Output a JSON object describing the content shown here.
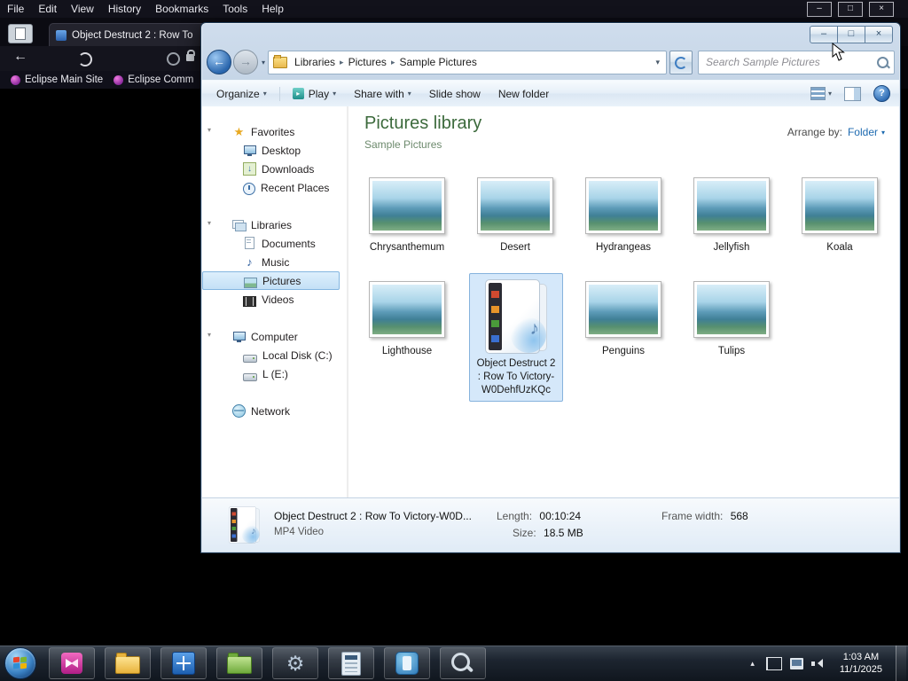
{
  "icons": {
    "back": "←",
    "forward": "→",
    "dropdown": "▾",
    "crumb_sep": "▸",
    "star": "★",
    "note": "♪",
    "down": "↓",
    "gear": "⚙",
    "help": "?",
    "play": "▸",
    "minimize": "–",
    "maximize": "□",
    "close": "×",
    "tray_up": "▴",
    "expand": "▾"
  },
  "browser": {
    "menu": [
      "File",
      "Edit",
      "View",
      "History",
      "Bookmarks",
      "Tools",
      "Help"
    ],
    "tab_title": "Object Destruct 2 :  Row To",
    "bookmarks": [
      "Eclipse Main Site",
      "Eclipse Comm"
    ]
  },
  "explorer": {
    "breadcrumb": [
      "Libraries",
      "Pictures",
      "Sample Pictures"
    ],
    "search_placeholder": "Search Sample Pictures",
    "toolbar": {
      "organize": "Organize",
      "play": "Play",
      "share_with": "Share with",
      "slide_show": "Slide show",
      "new_folder": "New folder"
    },
    "sidebar": {
      "favorites": "Favorites",
      "desktop": "Desktop",
      "downloads": "Downloads",
      "recent": "Recent Places",
      "libraries": "Libraries",
      "documents": "Documents",
      "music": "Music",
      "pictures": "Pictures",
      "videos": "Videos",
      "computer": "Computer",
      "disk_c": "Local Disk (C:)",
      "disk_e": "L (E:)",
      "network": "Network"
    },
    "header": {
      "title": "Pictures library",
      "location": "Sample Pictures",
      "arrange_label": "Arrange by:",
      "arrange_value": "Folder"
    },
    "items": [
      {
        "name": "Chrysanthemum"
      },
      {
        "name": "Desert"
      },
      {
        "name": "Hydrangeas"
      },
      {
        "name": "Jellyfish"
      },
      {
        "name": "Koala"
      },
      {
        "name": "Lighthouse"
      },
      {
        "name": "Object Destruct 2 :  Row To Victory-W0DehfUzKQc"
      },
      {
        "name": "Penguins"
      },
      {
        "name": "Tulips"
      }
    ],
    "details": {
      "name": "Object Destruct 2 :  Row To Victory-W0D...",
      "type": "MP4 Video",
      "length_label": "Length:",
      "length_value": "00:10:24",
      "size_label": "Size:",
      "size_value": "18.5 MB",
      "frame_width_label": "Frame width:",
      "frame_width_value": "568"
    }
  },
  "taskbar": {
    "time": "1:03 AM",
    "date": "11/1/2025"
  }
}
